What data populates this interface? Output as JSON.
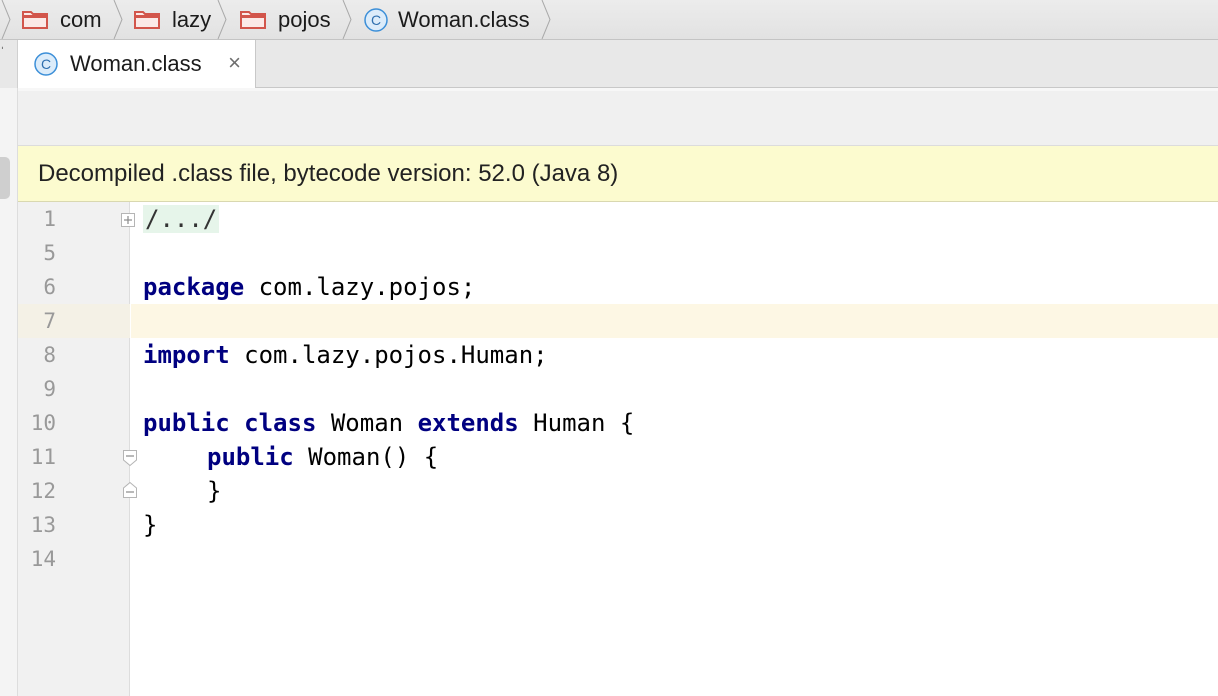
{
  "breadcrumb": {
    "items": [
      {
        "label": "com",
        "icon": "folder-icon"
      },
      {
        "label": "lazy",
        "icon": "folder-icon"
      },
      {
        "label": "pojos",
        "icon": "folder-icon"
      },
      {
        "label": "Woman.class",
        "icon": "class-icon"
      }
    ]
  },
  "tabs": [
    {
      "label": "Woman.class",
      "icon": "class-icon",
      "close_label": "×",
      "active": true
    }
  ],
  "banner": {
    "text": "Decompiled .class file, bytecode version: 52.0 (Java 8)"
  },
  "editor": {
    "current_line": "7",
    "lines": [
      {
        "num": "1"
      },
      {
        "num": "5"
      },
      {
        "num": "6"
      },
      {
        "num": "7"
      },
      {
        "num": "8"
      },
      {
        "num": "9"
      },
      {
        "num": "10"
      },
      {
        "num": "11"
      },
      {
        "num": "12"
      },
      {
        "num": "13"
      },
      {
        "num": "14"
      }
    ],
    "code": {
      "folded": "/.../",
      "package_kw": "package",
      "package_name": " com.lazy.pojos;",
      "import_kw": "import",
      "import_name": " com.lazy.pojos.Human;",
      "public_kw": "public",
      "class_kw": "class",
      "class_name": " Woman ",
      "extends_kw": "extends",
      "super_name": " Human {",
      "ctor_public_kw": "public",
      "ctor_sig": " Woman() {",
      "ctor_close": "}",
      "class_close": "}"
    }
  },
  "colors": {
    "keyword": "#000080",
    "banner_bg": "#fcfbcf",
    "current_line_bg": "#fdf7e4",
    "folder_icon": "#d2554b",
    "class_icon": "#3c8fd8"
  }
}
